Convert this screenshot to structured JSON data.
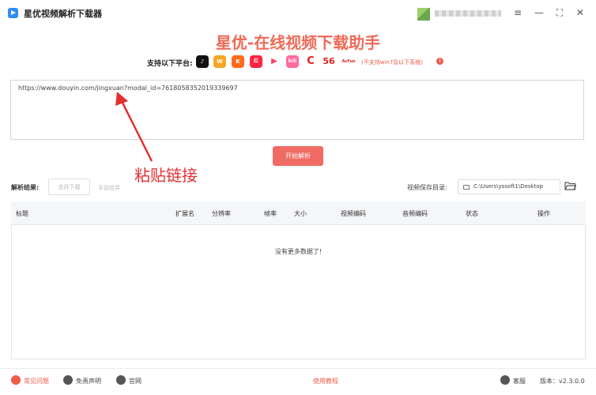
{
  "window": {
    "title": "星优视频解析下载器",
    "controls": [
      "≡",
      "—",
      "⛶",
      "✕"
    ]
  },
  "header": {
    "headline": "星优-在线视频下载助手",
    "platforms_label": "支持以下平台:",
    "platforms": [
      {
        "name": "douyin",
        "icon": "douyin-icon",
        "color": "#111111",
        "glyph": "♪"
      },
      {
        "name": "weibo",
        "icon": "weibo-icon",
        "color": "#f5a623",
        "glyph": "W"
      },
      {
        "name": "kuaishou",
        "icon": "kuaishou-icon",
        "color": "#ff6a1a",
        "glyph": "K"
      },
      {
        "name": "xiaohongshu",
        "icon": "xiaohongshu-icon",
        "color": "#ff2442",
        "glyph": "红"
      },
      {
        "name": "haokan",
        "icon": "haokan-icon",
        "color": "#ffffff",
        "glyph": "▶"
      },
      {
        "name": "bilibili",
        "icon": "bilibili-icon",
        "color": "#ff6b9a",
        "glyph": "bili"
      },
      {
        "name": "cctv",
        "icon": "cctv-icon",
        "color": "#e02020",
        "glyph": "C"
      },
      {
        "name": "56",
        "icon": "56-icon",
        "color": "#ffffff",
        "glyph": "56"
      },
      {
        "name": "acfun",
        "icon": "acfun-icon",
        "color": "#ffffff",
        "glyph": "AcFun"
      }
    ],
    "notice": "(不支持win7及以下系统)"
  },
  "input": {
    "url_value": "https://www.douyin.com/jingxuan?modal_id=7618058352019339697"
  },
  "buttons": {
    "parse": "开始解析"
  },
  "annotation": "粘贴链接",
  "results": {
    "label": "解析结果:",
    "merge_download": "合并下载",
    "manual_merge": "手动合并",
    "save_dir_label": "视频保存目录:",
    "save_dir_value": "C:\\Users\\yssoft1\\Desktop"
  },
  "table": {
    "columns": [
      "标题",
      "扩展名",
      "分辨率",
      "帧率",
      "大小",
      "视频编码",
      "音频编码",
      "状态",
      "操作"
    ],
    "empty_text": "没有更多数据了!"
  },
  "footer": {
    "faq": "常见问题",
    "disclaimer": "免责声明",
    "website": "官网",
    "tutorial": "使用教程",
    "support": "客服",
    "version": "版本：v2.3.0.0"
  },
  "colors": {
    "accent": "#ef6a57",
    "button": "#f06b63",
    "annotation": "#e43030"
  }
}
